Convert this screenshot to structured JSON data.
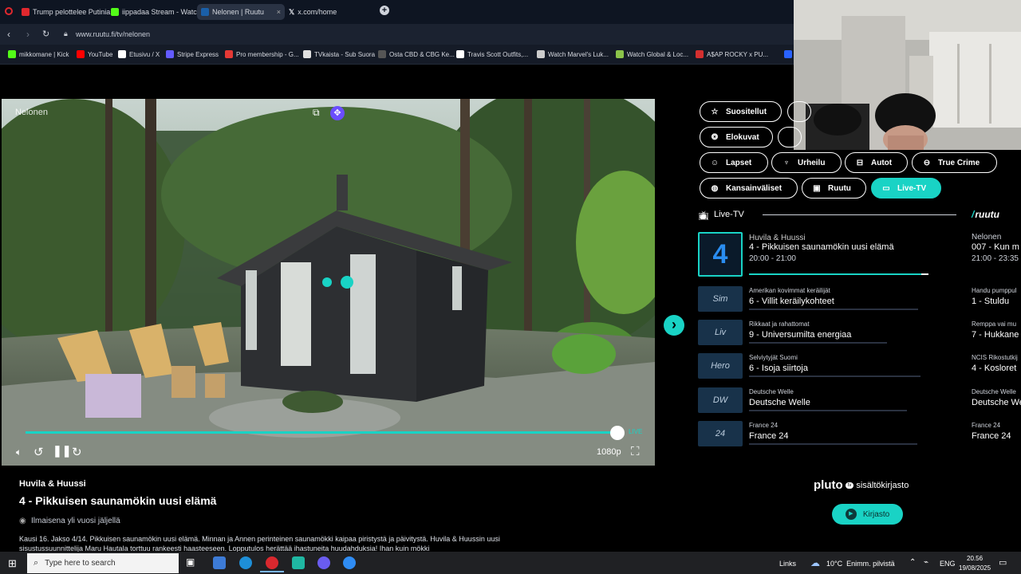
{
  "browser": {
    "tabs": [
      {
        "title": "Trump pelottelee Putinia",
        "color": "#e0282e"
      },
      {
        "title": "iippadaa Stream - Watch",
        "color": "#53fc18"
      },
      {
        "title": "Nelonen | Ruutu",
        "color": "#1a5fa8"
      },
      {
        "title": "x.com/home",
        "color": "#ffffff"
      }
    ],
    "new_tab": "+",
    "url": "www.ruutu.fi/tv/nelonen",
    "bookmarks": [
      {
        "label": "mikkomane | Kick",
        "color": "#53fc18"
      },
      {
        "label": "YouTube",
        "color": "#ff0000"
      },
      {
        "label": "Etusivu / X",
        "color": "#ffffff"
      },
      {
        "label": "Stripe Express",
        "color": "#635bff"
      },
      {
        "label": "Pro membership - G...",
        "color": "#e53935"
      },
      {
        "label": "TVkaista - Sub Suora",
        "color": "#e0e0e0"
      },
      {
        "label": "Osta CBD & CBG Ke...",
        "color": "#555555"
      },
      {
        "label": "Travis Scott Outfits,...",
        "color": "#ffffff"
      },
      {
        "label": "Watch Marvel's Luk...",
        "color": "#cccccc"
      },
      {
        "label": "Watch Global & Loc...",
        "color": "#8bc34a"
      },
      {
        "label": "A$AP ROCKY x PU...",
        "color": "#d32f2f"
      },
      {
        "label": "de",
        "color": "#2962ff"
      }
    ]
  },
  "player": {
    "channel_watermark": "Nelonen",
    "live_label": "LIVE",
    "quality": "1080p",
    "progress": 1.0
  },
  "program": {
    "series": "Huvila & Huussi",
    "title": "4 - Pikkuisen saunamökin uusi elämä",
    "availability": "Ilmaisena yli vuosi jäljellä",
    "description": "Kausi 16. Jakso 4/14. Pikkuisen saunamökin uusi elämä. Minnan ja Annen perinteinen saunamökki kaipaa piristystä ja päivitystä. Huvila & Huussin uusi sisustussuunnittelija Maru Hautala torttuu rankeesti haasteeseen. Lopputulos herättää ihastuneita huudahduksia! Ihan kuin mökki"
  },
  "categories": [
    {
      "label": "Suositellut",
      "icon": "☆",
      "active": false
    },
    {
      "label": "Elokuvat",
      "icon": "❂",
      "active": false
    },
    {
      "label": "Lapset",
      "icon": "☺",
      "active": false
    },
    {
      "label": "Urheilu",
      "icon": "♆",
      "active": false
    },
    {
      "label": "Autot",
      "icon": "⊟",
      "active": false
    },
    {
      "label": "True Crime",
      "icon": "⊖",
      "active": false
    },
    {
      "label": "Kansainväliset",
      "icon": "◍",
      "active": false
    },
    {
      "label": "Ruutu",
      "icon": "▣",
      "active": false
    },
    {
      "label": "Live-TV",
      "icon": "▭",
      "active": true
    }
  ],
  "live_section": {
    "heading": "Live-TV",
    "brand": "ruutu",
    "channels": [
      {
        "logo": "4",
        "sub": "Huvila & Huussi",
        "title": "4 - Pikkuisen saunamökin uusi elämä",
        "time": "20:00 - 21:00",
        "progress": 0.96
      },
      {
        "logo": "Sim",
        "sub": "Amerikan kovimmat keräilijät",
        "title": "6 - Villit keräilykohteet"
      },
      {
        "logo": "Liv",
        "sub": "Rikkaat ja rahattomat",
        "title": "9 - Universumilta energiaa"
      },
      {
        "logo": "Hero",
        "sub": "Selviytyjät Suomi",
        "title": "6 - Isoja siirtoja"
      },
      {
        "logo": "DW",
        "sub": "Deutsche Welle",
        "title": "Deutsche Welle"
      },
      {
        "logo": "24",
        "sub": "France 24",
        "title": "France 24"
      }
    ],
    "next_column": [
      {
        "sub": "Nelonen",
        "title": "007 - Kun m",
        "time": "21:00 - 23:35"
      },
      {
        "sub": "Handu pumppul",
        "title": "1 - Stuldu"
      },
      {
        "sub": "Remppa vai mu",
        "title": "7 - Hukkane"
      },
      {
        "sub": "NCIS Rikostutkij",
        "title": "4 - Kosloret"
      },
      {
        "sub": "Deutsche Welle",
        "title": "Deutsche We"
      },
      {
        "sub": "France 24",
        "title": "France 24"
      }
    ]
  },
  "pluto": {
    "brand": "pluto",
    "badge": "tv",
    "label": "sisältökirjasto",
    "button": "Kirjasto"
  },
  "taskbar": {
    "search_placeholder": "Type here to search",
    "links": "Links",
    "weather": "10°C  Enimm. pilvistä",
    "lang": "ENG",
    "time": "20.56",
    "date": "19/08/2025"
  }
}
